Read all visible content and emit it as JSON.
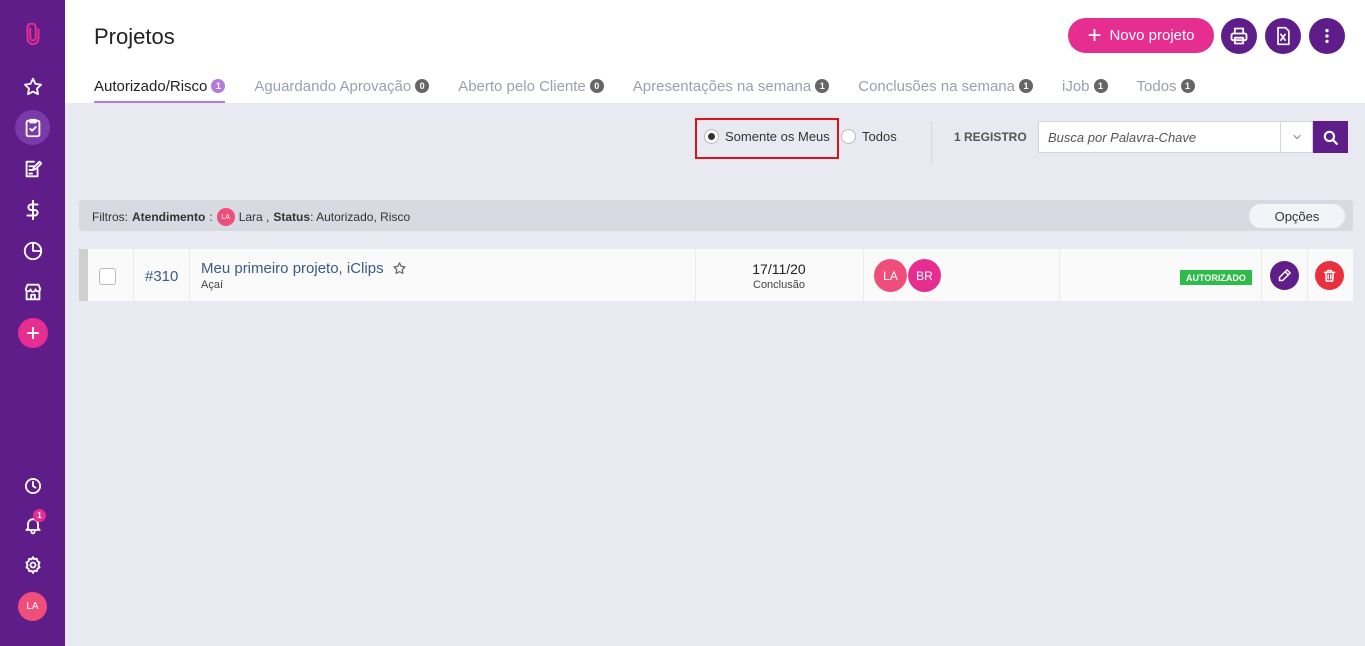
{
  "app": {
    "title": "Projetos"
  },
  "header": {
    "new_project_label": "Novo projeto",
    "print_icon": "print-icon",
    "excel_icon": "excel-icon",
    "more_icon": "more-vertical-icon"
  },
  "tabs": [
    {
      "label": "Autorizado/Risco",
      "count": "1",
      "active": true
    },
    {
      "label": "Aguardando Aprovação",
      "count": "0",
      "active": false
    },
    {
      "label": "Aberto pelo Cliente",
      "count": "0",
      "active": false
    },
    {
      "label": "Apresentações na semana",
      "count": "1",
      "active": false
    },
    {
      "label": "Conclusões na semana",
      "count": "1",
      "active": false
    },
    {
      "label": "iJob",
      "count": "1",
      "active": false
    },
    {
      "label": "Todos",
      "count": "1",
      "active": false
    }
  ],
  "filters": {
    "radio_mine": "Somente os Meus",
    "radio_all": "Todos",
    "selected": "mine",
    "record_count": "1 REGISTRO",
    "search_placeholder": "Busca por Palavra-Chave"
  },
  "filter_strip": {
    "prefix": "Filtros:",
    "atendimento_label": "Atendimento",
    "atendimento_avatar": "LA",
    "atendimento_value": "Lara ,",
    "status_label": "Status",
    "status_value": ": Autorizado, Risco",
    "options_label": "Opções"
  },
  "rows": [
    {
      "id": "#310",
      "title": "Meu primeiro projeto, iClips",
      "client": "Açaí",
      "date": "17/11/20",
      "date_label": "Conclusão",
      "avatars": [
        {
          "initials": "LA",
          "color": "#f04e7a"
        },
        {
          "initials": "BR",
          "color": "#e52e8f"
        }
      ],
      "status": "AUTORIZADO",
      "status_color": "#2dbb4a"
    }
  ],
  "sidebar": {
    "items": [
      "logo-icon",
      "star-icon",
      "clipboard-check-icon",
      "edit-note-icon",
      "dollar-icon",
      "pie-chart-icon",
      "store-icon",
      "add-icon"
    ],
    "bottom": [
      "clock-icon",
      "bell-icon",
      "gear-icon"
    ],
    "notification_count": "1",
    "user_initials": "LA"
  },
  "colors": {
    "sidebar": "#5f1d8a",
    "accent": "#e52e8f",
    "tab_active": "#b57bd9",
    "danger": "#e8303f",
    "highlight_border": "#e0101a"
  }
}
